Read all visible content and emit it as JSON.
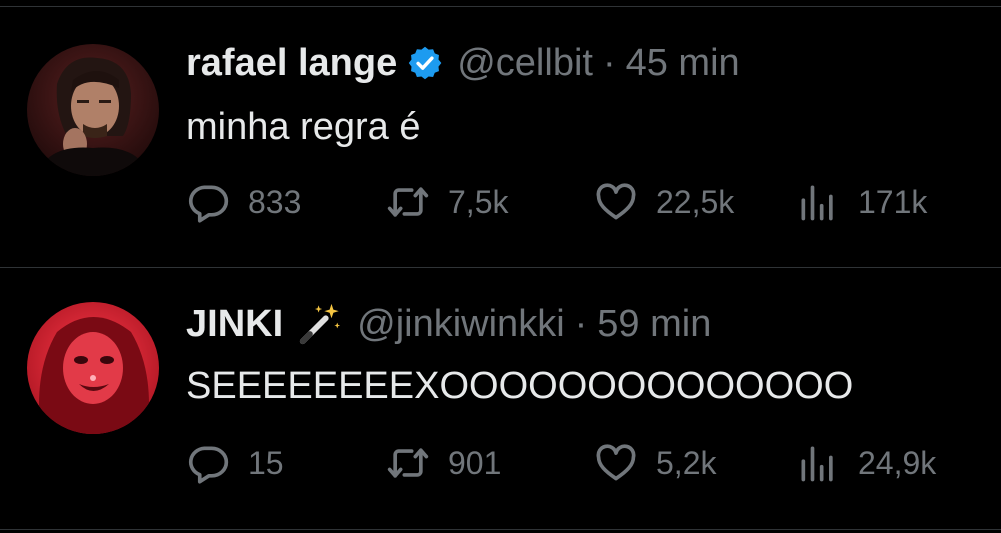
{
  "colors": {
    "background": "#000000",
    "text_primary": "#e7e9ea",
    "text_secondary": "#71767b",
    "verified_badge": "#1d9bf0",
    "separator": "#2f3336"
  },
  "tweets": [
    {
      "author_name": "rafael lange",
      "verified": true,
      "badge_icon": "verified-badge-icon",
      "handle": "@cellbit",
      "separator": "·",
      "time": "45 min",
      "text": "minha regra é",
      "replies": "833",
      "retweets": "7,5k",
      "likes": "22,5k",
      "views": "171k"
    },
    {
      "author_name": "JINKI",
      "verified": false,
      "name_emoji_icon": "magic-wand-icon",
      "handle": "@jinkiwinkki",
      "separator": "·",
      "time": "59 min",
      "text": "SEEEEEEEEXOOOOOOOOOOOOOO",
      "replies": "15",
      "retweets": "901",
      "likes": "5,2k",
      "views": "24,9k"
    }
  ]
}
